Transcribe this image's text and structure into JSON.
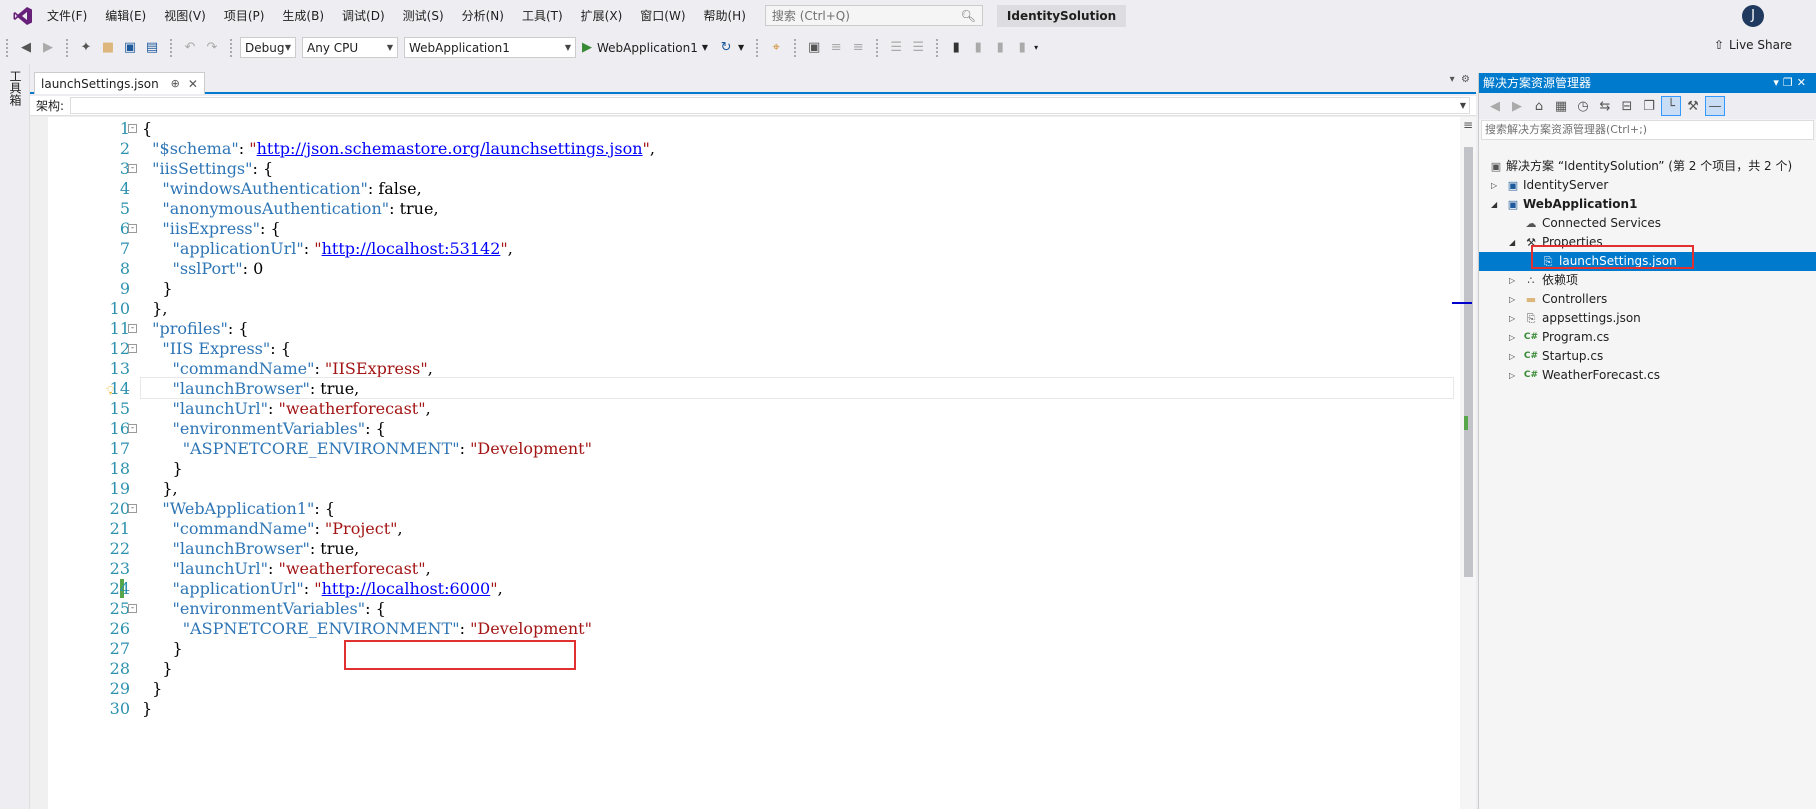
{
  "menubar": {
    "items": [
      "文件(F)",
      "编辑(E)",
      "视图(V)",
      "项目(P)",
      "生成(B)",
      "调试(D)",
      "测试(S)",
      "分析(N)",
      "工具(T)",
      "扩展(X)",
      "窗口(W)",
      "帮助(H)"
    ],
    "search_placeholder": "搜索 (Ctrl+Q)",
    "solution_title": "IdentitySolution",
    "avatar_initial": "J"
  },
  "toolbar": {
    "configuration": "Debug",
    "platform": "Any CPU",
    "startup_project": "WebApplication1",
    "run_label": "WebApplication1",
    "live_share": "Live Share"
  },
  "toolbox": {
    "label": "工具箱"
  },
  "document": {
    "tab_title": "launchSettings.json",
    "schema_label": "架构:",
    "schema_value": ""
  },
  "code": {
    "lines": [
      "1",
      "2",
      "3",
      "4",
      "5",
      "6",
      "7",
      "8",
      "9",
      "10",
      "11",
      "12",
      "13",
      "14",
      "15",
      "16",
      "17",
      "18",
      "19",
      "20",
      "21",
      "22",
      "23",
      "24",
      "25",
      "26",
      "27",
      "28",
      "29",
      "30"
    ]
  },
  "solution_explorer": {
    "title": "解决方案资源管理器",
    "search_placeholder": "搜索解决方案资源管理器(Ctrl+;)",
    "tree": [
      {
        "label": "解决方案 “IdentitySolution” (第 2 个项目，共 2 个)",
        "icon": "solution-icon"
      },
      {
        "label": "IdentityServer",
        "icon": "web-project-icon"
      },
      {
        "label": "WebApplication1",
        "icon": "web-project-icon"
      },
      {
        "label": "Connected Services",
        "icon": "connected-services-icon"
      },
      {
        "label": "Properties",
        "icon": "wrench-icon"
      },
      {
        "label": "launchSettings.json",
        "icon": "json-file-icon"
      },
      {
        "label": "依赖项",
        "icon": "dependencies-icon"
      },
      {
        "label": "Controllers",
        "icon": "folder-icon"
      },
      {
        "label": "appsettings.json",
        "icon": "json-file-icon"
      },
      {
        "label": "Program.cs",
        "icon": "csharp-file-icon"
      },
      {
        "label": "Startup.cs",
        "icon": "csharp-file-icon"
      },
      {
        "label": "WeatherForecast.cs",
        "icon": "csharp-file-icon"
      }
    ]
  },
  "colors": {
    "accent": "#007acc",
    "highlight_box": "#e03030",
    "json_key": "#2e75b6",
    "json_string": "#a31515",
    "url": "#0000ff",
    "line_number": "#2b91af"
  }
}
